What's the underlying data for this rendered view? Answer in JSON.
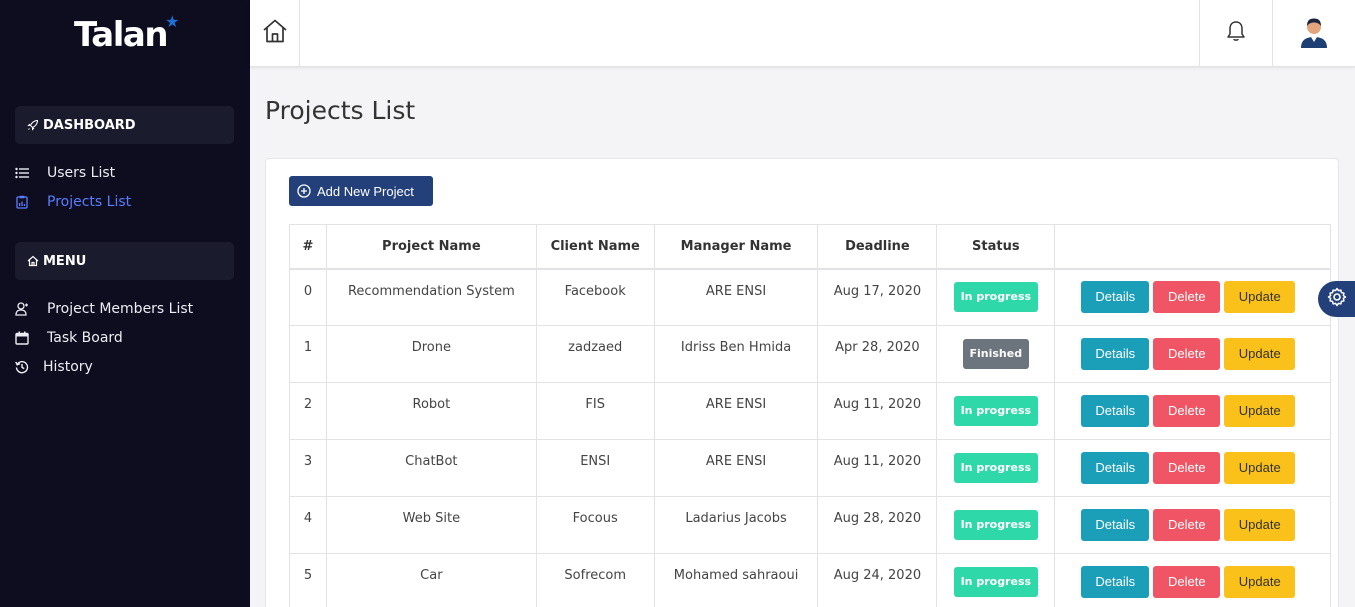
{
  "sidebar": {
    "logo_text": "Talan",
    "dashboard_label": "DASHBOARD",
    "menu_label": "MENU",
    "items": [
      {
        "label": "Users List"
      },
      {
        "label": "Projects List"
      },
      {
        "label": "Project Members List"
      },
      {
        "label": "Task Board"
      },
      {
        "label": "History"
      }
    ]
  },
  "page": {
    "title": "Projects List",
    "add_button": "Add New Project"
  },
  "table": {
    "headers": [
      "#",
      "Project Name",
      "Client Name",
      "Manager Name",
      "Deadline",
      "Status",
      ""
    ],
    "rows": [
      {
        "index": "0",
        "project": "Recommendation System",
        "client": "Facebook",
        "manager": "ARE ENSI",
        "deadline": "Aug 17, 2020",
        "status": "In progress"
      },
      {
        "index": "1",
        "project": "Drone",
        "client": "zadzaed",
        "manager": "Idriss Ben Hmida",
        "deadline": "Apr 28, 2020",
        "status": "Finished"
      },
      {
        "index": "2",
        "project": "Robot",
        "client": "FIS",
        "manager": "ARE ENSI",
        "deadline": "Aug 11, 2020",
        "status": "In progress"
      },
      {
        "index": "3",
        "project": "ChatBot",
        "client": "ENSI",
        "manager": "ARE ENSI",
        "deadline": "Aug 11, 2020",
        "status": "In progress"
      },
      {
        "index": "4",
        "project": "Web Site",
        "client": "Focous",
        "manager": "Ladarius Jacobs",
        "deadline": "Aug 28, 2020",
        "status": "In progress"
      },
      {
        "index": "5",
        "project": "Car",
        "client": "Sofrecom",
        "manager": "Mohamed sahraoui",
        "deadline": "Aug 24, 2020",
        "status": "In progress"
      }
    ],
    "actions": {
      "details": "Details",
      "delete": "Delete",
      "update": "Update"
    }
  },
  "icons": {
    "home": "home-icon",
    "bell": "bell-icon",
    "avatar": "user-avatar-icon",
    "gear": "gear-icon",
    "rocket": "rocket-icon",
    "list": "list-icon",
    "clipboard": "clipboard-icon",
    "members": "members-icon",
    "calendar": "calendar-icon",
    "history": "history-icon",
    "plus_circle": "plus-circle-icon"
  },
  "colors": {
    "sidebar_bg": "#0d0d1f",
    "active_link": "#5a7dff",
    "primary": "#23407a",
    "details": "#1b9eb8",
    "delete": "#ef5565",
    "update": "#fbc11b",
    "in_progress": "#2ed8a9",
    "finished": "#6c757d"
  }
}
